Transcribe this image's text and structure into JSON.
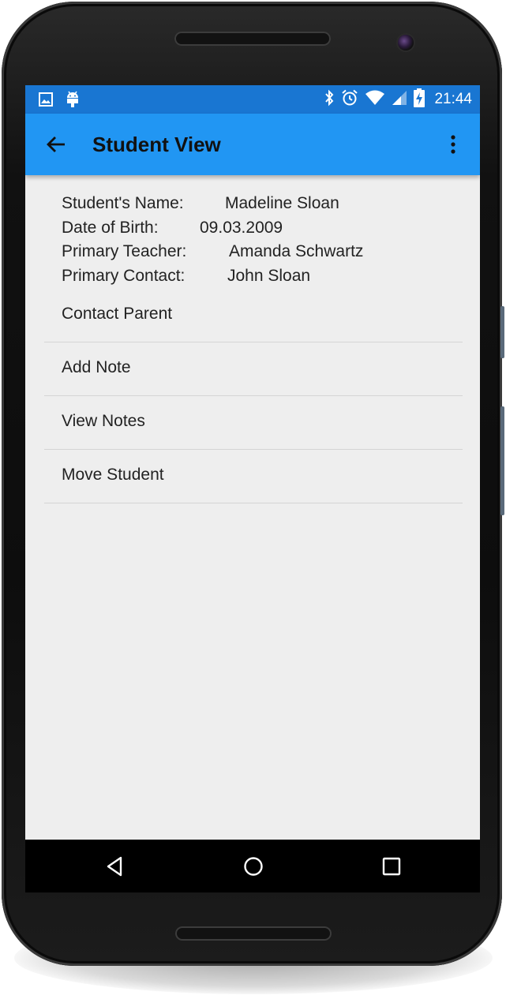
{
  "statusbar": {
    "left_icons": [
      "image-icon",
      "android-icon"
    ],
    "right_icons": [
      "bluetooth-icon",
      "alarm-icon",
      "wifi-icon",
      "signal-icon",
      "battery-charging-icon"
    ],
    "time": "21:44"
  },
  "appbar": {
    "title": "Student View",
    "back_icon": "arrow-left-icon",
    "overflow_icon": "more-vert-icon"
  },
  "student": {
    "fields": [
      {
        "label": "Student's Name:",
        "value": "Madeline Sloan"
      },
      {
        "label": "Date of Birth:",
        "value": "09.03.2009"
      },
      {
        "label": "Primary Teacher:",
        "value": "Amanda Schwartz"
      },
      {
        "label": "Primary Contact:",
        "value": "John Sloan"
      }
    ]
  },
  "actions": [
    {
      "label": "Contact Parent"
    },
    {
      "label": "Add Note"
    },
    {
      "label": "View Notes"
    },
    {
      "label": "Move Student"
    }
  ],
  "navbar": {
    "icons": [
      "nav-back-icon",
      "nav-home-icon",
      "nav-recents-icon"
    ]
  },
  "colors": {
    "statusbar": "#1976d2",
    "appbar": "#2196f3",
    "content_bg": "#eeeeee",
    "navbar": "#000000"
  }
}
